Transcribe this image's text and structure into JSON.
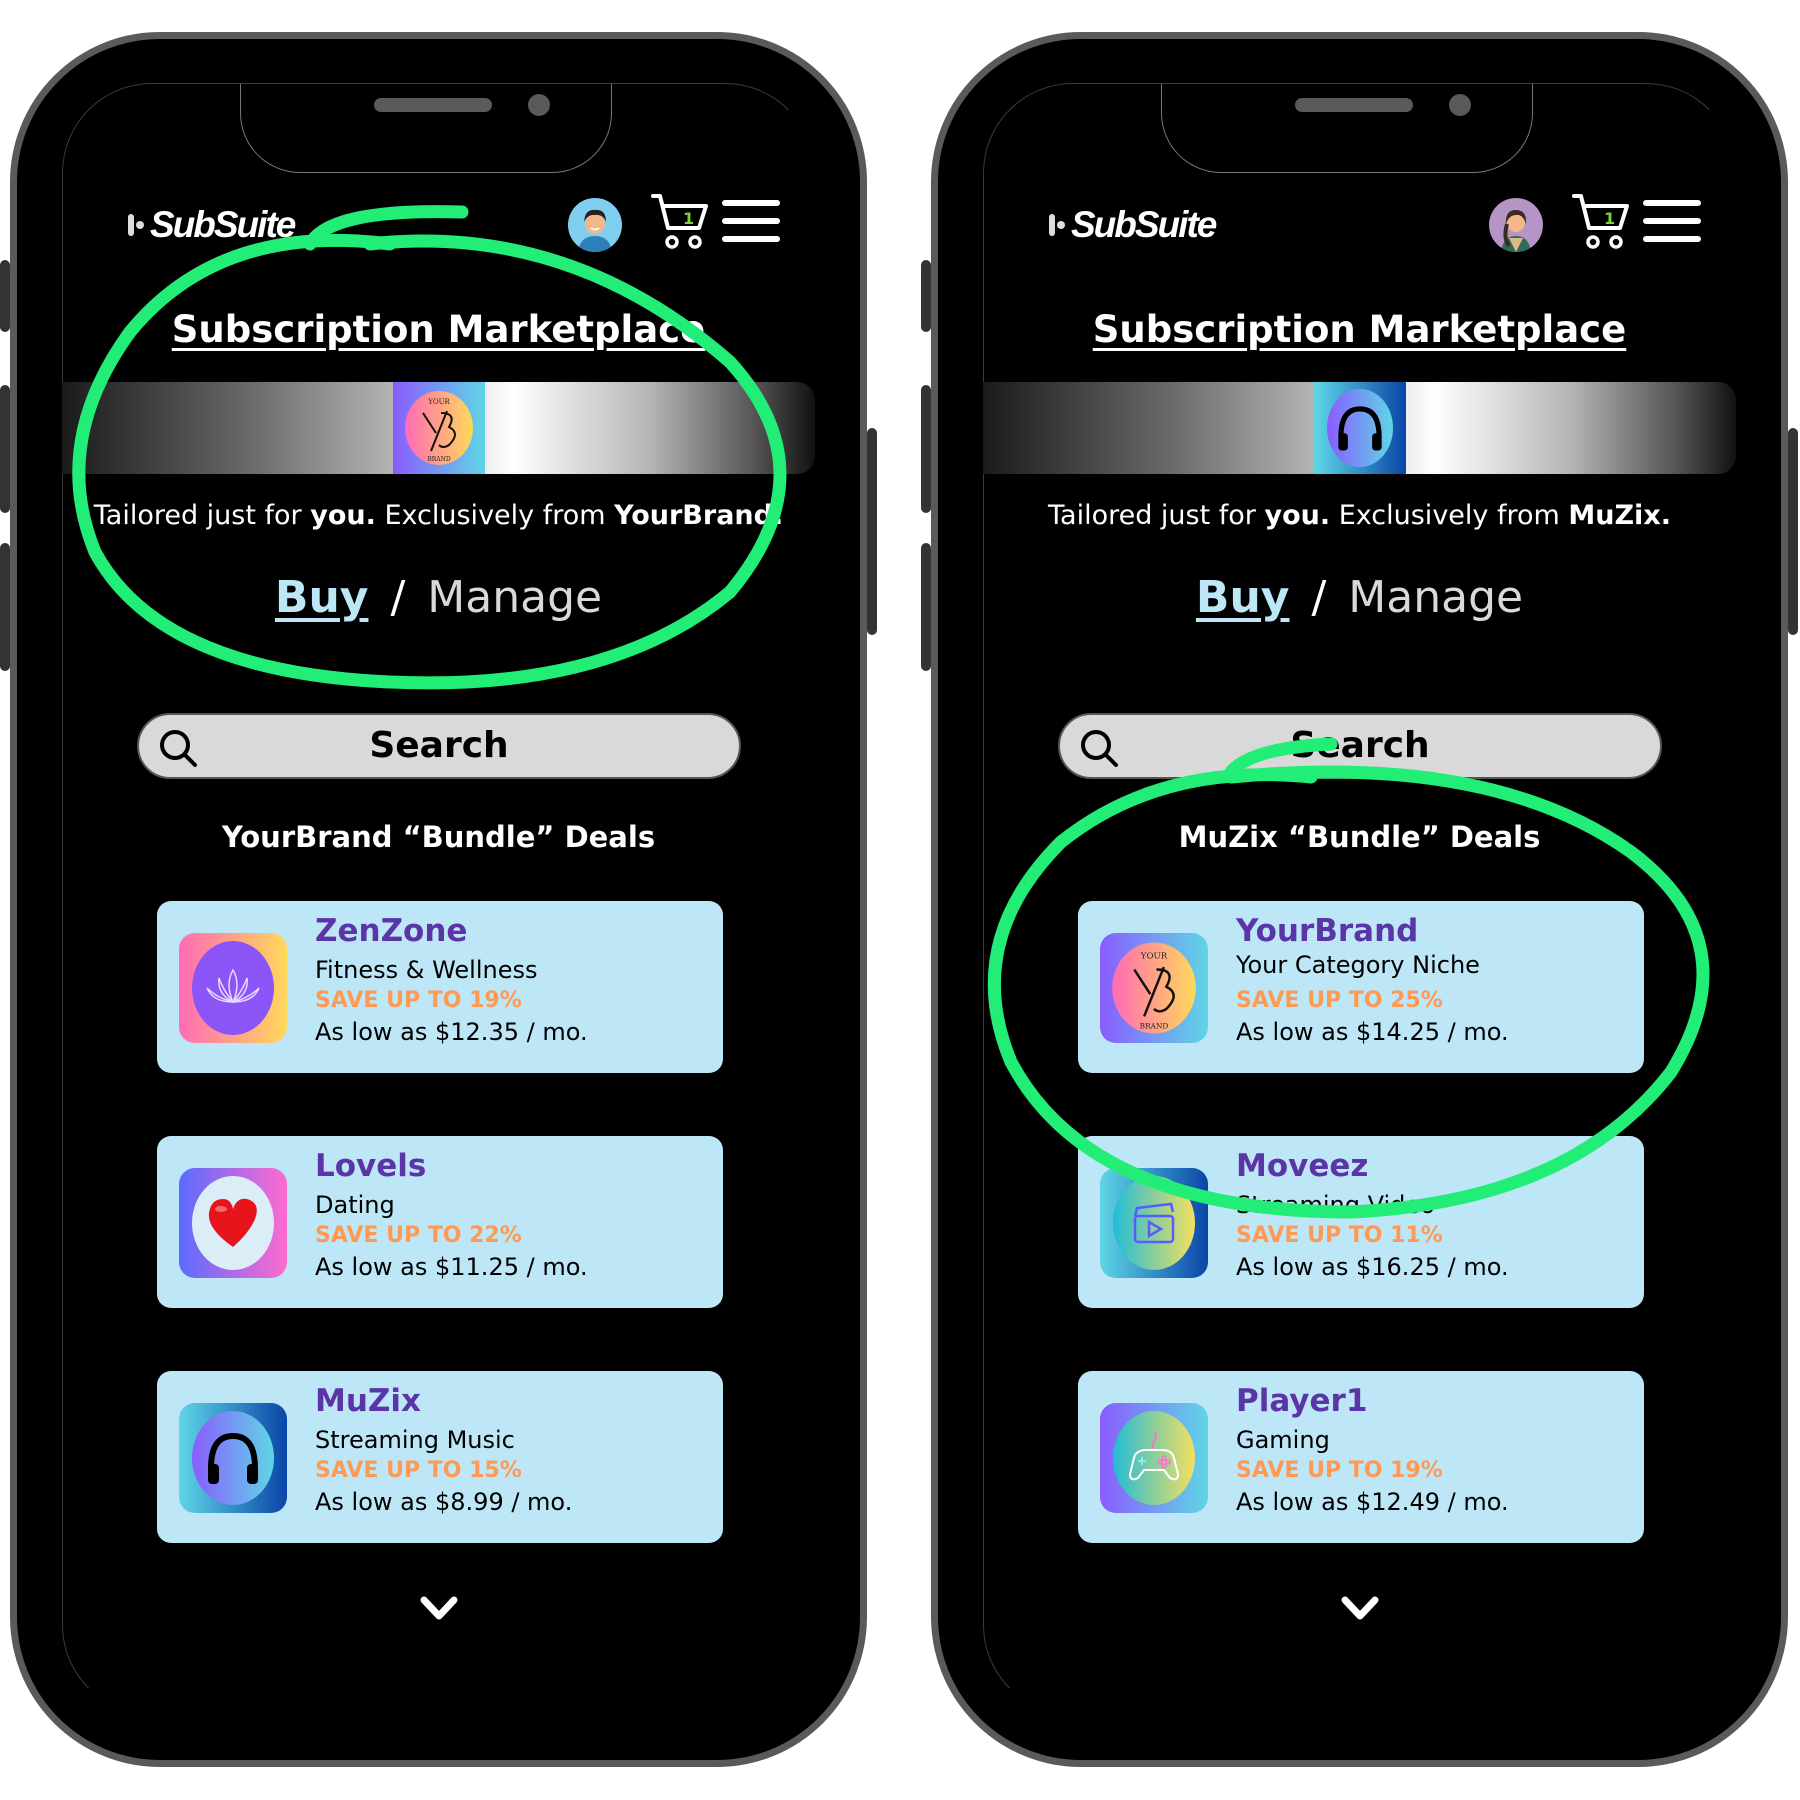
{
  "phones": [
    {
      "logo": "SubSuite",
      "cart_count": "1",
      "avatar": "male-user-avatar",
      "title": "Subscription Marketplace",
      "banner_brand": "YourBrand",
      "tagline": {
        "pre": "Tailored just for ",
        "you": "you.",
        "mid": " Exclusively from ",
        "brand": "YourBrand."
      },
      "nav": {
        "buy": "Buy",
        "slash": "/",
        "manage": "Manage"
      },
      "search_label": "Search",
      "section_title": "YourBrand “Bundle” Deals",
      "deals": [
        {
          "name": "ZenZone",
          "category": "Fitness & Wellness",
          "save": "SAVE UP TO 19%",
          "price": "As low as $12.35 / mo.",
          "icon": "lotus-icon"
        },
        {
          "name": "Lovels",
          "category": "Dating",
          "save": "SAVE UP TO 22%",
          "price": "As low as $11.25 / mo.",
          "icon": "heart-icon"
        },
        {
          "name": "MuZix",
          "category": "Streaming Music",
          "save": "SAVE UP TO 15%",
          "price": "As low as $8.99 / mo.",
          "icon": "headphones-icon"
        }
      ]
    },
    {
      "logo": "SubSuite",
      "cart_count": "1",
      "avatar": "female-user-avatar",
      "title": "Subscription Marketplace",
      "banner_brand": "MuZix",
      "tagline": {
        "pre": "Tailored just for ",
        "you": "you.",
        "mid": " Exclusively from ",
        "brand": "MuZix."
      },
      "nav": {
        "buy": "Buy",
        "slash": "/",
        "manage": "Manage"
      },
      "search_label": "Search",
      "section_title": "MuZix “Bundle” Deals",
      "deals": [
        {
          "name": "YourBrand",
          "category": "Your Category Niche",
          "save": "SAVE UP TO 25%",
          "price": "As low as $14.25 / mo.",
          "icon": "yourbrand-logo-icon"
        },
        {
          "name": "Moveez",
          "category": "Streaming Video",
          "save": "SAVE UP TO 11%",
          "price": "As low as $16.25 / mo.",
          "icon": "clapperboard-icon"
        },
        {
          "name": "Player1",
          "category": "Gaming",
          "save": "SAVE UP TO 19%",
          "price": "As low as $12.49 / mo.",
          "icon": "gamepad-icon"
        }
      ]
    }
  ],
  "yb_logo_text": {
    "top": "YOUR",
    "mark": "YB",
    "bottom": "BRAND"
  },
  "colors": {
    "card_bg": "#bde6f6",
    "deal_name": "#5b35a8",
    "save_text": "#ff9a55",
    "buy_link": "#bde6f6",
    "annotation": "#22ee77",
    "cart_badge": "#7cd63a"
  }
}
